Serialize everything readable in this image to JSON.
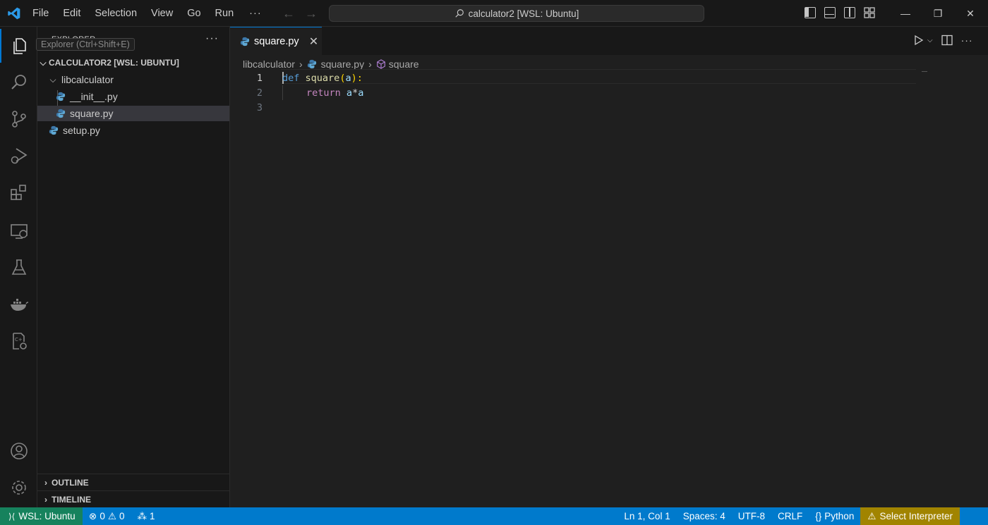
{
  "titlebar": {
    "menu": [
      "File",
      "Edit",
      "Selection",
      "View",
      "Go",
      "Run"
    ],
    "more": "···",
    "command_center": "calculator2 [WSL: Ubuntu]"
  },
  "activitybar": {
    "items": [
      "explorer-icon",
      "search-icon",
      "source-control-icon",
      "run-debug-icon",
      "extensions-icon",
      "remote-explorer-icon",
      "testing-icon",
      "docker-icon",
      "cmake-icon"
    ],
    "bottom": [
      "account-icon",
      "settings-gear-icon"
    ]
  },
  "sidebar": {
    "title": "EXPLORER",
    "tooltip": "Explorer (Ctrl+Shift+E)",
    "more": "···",
    "root": "CALCULATOR2 [WSL: UBUNTU]",
    "folder": "libcalculator",
    "files": [
      "__init__.py",
      "square.py"
    ],
    "root_file": "setup.py",
    "outline": "OUTLINE",
    "timeline": "TIMELINE"
  },
  "editor": {
    "tab": "square.py",
    "breadcrumb": [
      "libcalculator",
      "square.py",
      "square"
    ],
    "lines": [
      {
        "n": "1",
        "def": "def",
        "fn": "square",
        "p1": "(",
        "arg": "a",
        "p2": "):"
      },
      {
        "n": "2",
        "ret": "return",
        "expr1": "a",
        "op": "*",
        "expr2": "a"
      },
      {
        "n": "3"
      }
    ]
  },
  "statusbar": {
    "remote": "WSL: Ubuntu",
    "errors": "0",
    "warnings": "0",
    "ports": "1",
    "position": "Ln 1, Col 1",
    "spaces": "Spaces: 4",
    "encoding": "UTF-8",
    "eol": "CRLF",
    "language": "Python",
    "interpreter": "Select Interpreter"
  },
  "colors": {
    "accent": "#0078d4",
    "statusbar": "#007acc",
    "remote": "#16825d",
    "warning": "#a18400"
  }
}
